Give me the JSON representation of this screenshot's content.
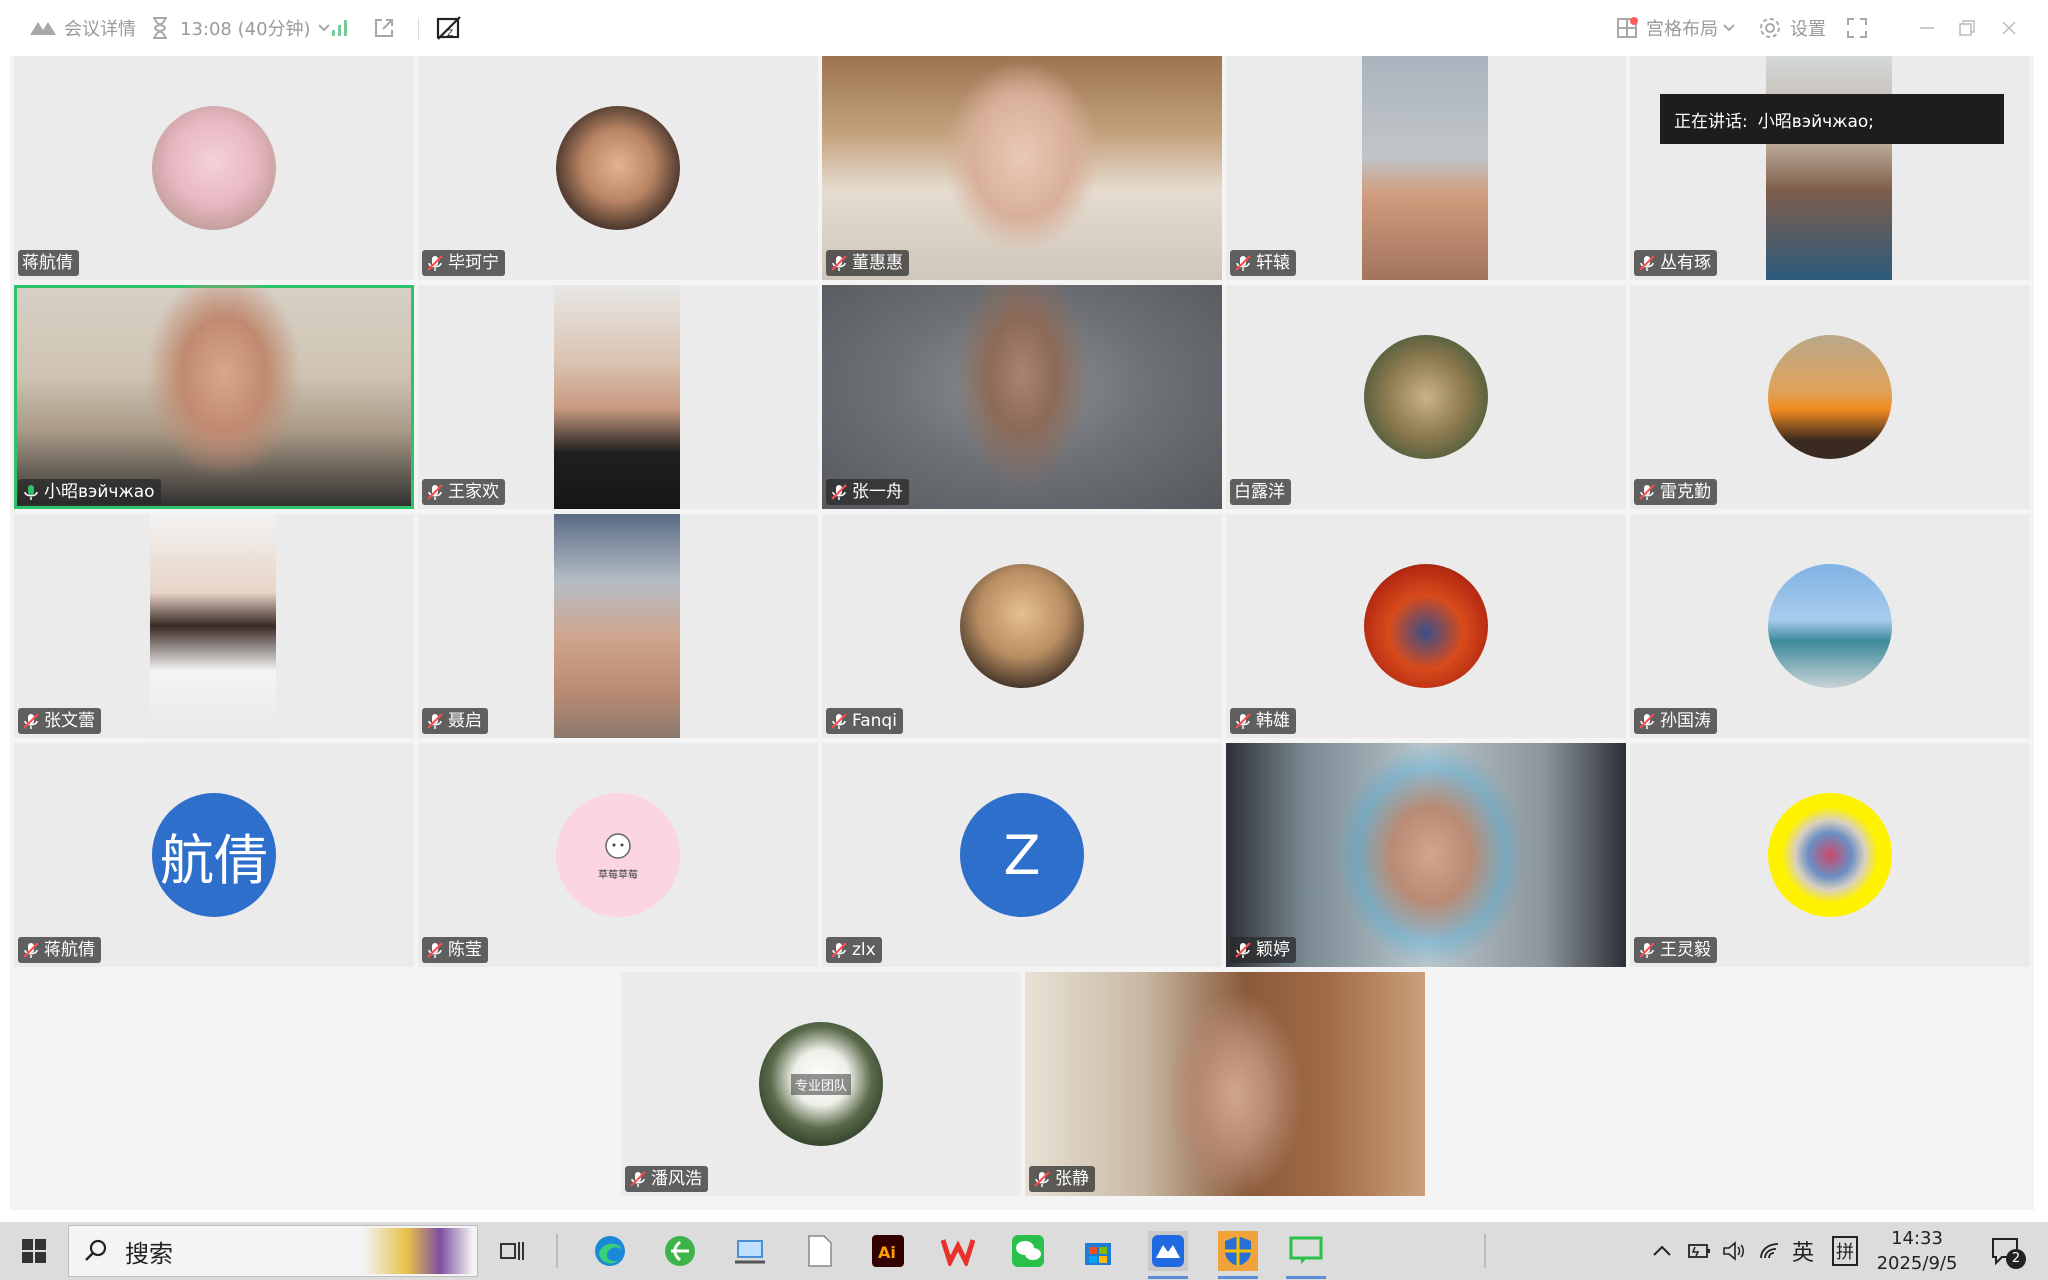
{
  "titlebar": {
    "meeting_info": "会议详情",
    "timer": "13:08 (40分钟)",
    "layout_label": "宫格布局",
    "settings_label": "设置"
  },
  "speaking": {
    "label": "正在讲话:",
    "name": "小昭вэйчжао;"
  },
  "participants": [
    {
      "name": "蒋航倩"
    },
    {
      "name": "毕珂宁"
    },
    {
      "name": "董惠惠"
    },
    {
      "name": "轩辕"
    },
    {
      "name": "丛有琢"
    },
    {
      "name": "小昭вэйчжао"
    },
    {
      "name": "王家欢"
    },
    {
      "name": "张一舟"
    },
    {
      "name": "白露洋"
    },
    {
      "name": "雷克勤"
    },
    {
      "name": "张文蕾"
    },
    {
      "name": "聂启"
    },
    {
      "name": "Fanqi"
    },
    {
      "name": "韩雄"
    },
    {
      "name": "孙国涛"
    },
    {
      "name": "蒋航倩",
      "avatar_text": "航倩"
    },
    {
      "name": "陈莹",
      "avatar_text": "草莓草莓"
    },
    {
      "name": "zlx",
      "avatar_text": "Z"
    },
    {
      "name": "颖婷"
    },
    {
      "name": "王灵毅"
    },
    {
      "name": "潘风浩",
      "avatar_text": "专业团队"
    },
    {
      "name": "张静"
    }
  ],
  "taskbar": {
    "search_label": "搜索",
    "ime_lang": "英",
    "ime_mode": "拼",
    "time": "14:33",
    "date": "2025/9/5",
    "notification_count": "2"
  },
  "colors": {
    "active_speaker": "#2cc36b",
    "avatar_blue": "#2d6fcb"
  }
}
